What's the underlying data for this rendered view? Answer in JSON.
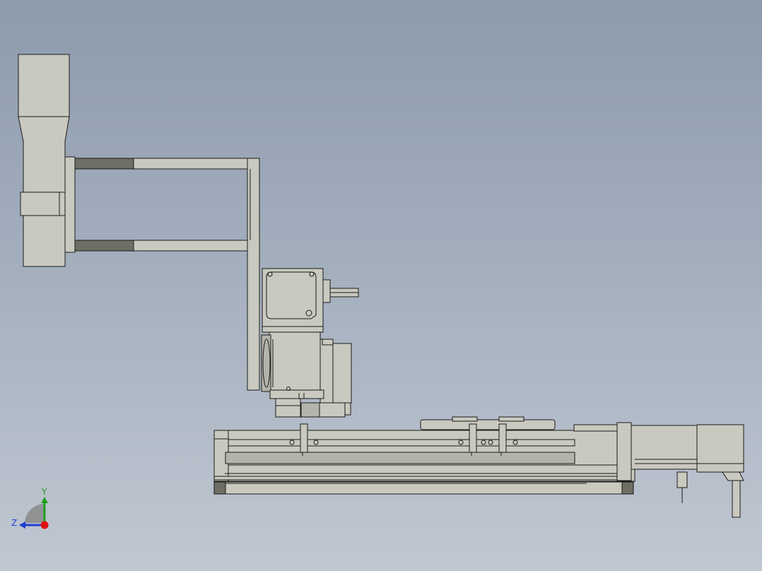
{
  "viewport": {
    "background_top": "#8d9bad",
    "background_bottom": "#c0c7d2"
  },
  "triad": {
    "y_label": "Y",
    "z_label": "Z",
    "y_color": "#1fa01f",
    "z_color": "#1f3fd0",
    "x_color": "#e01010"
  },
  "part_colors": {
    "body": "#c9c9c0",
    "dark_pad": "#6e6e64"
  }
}
